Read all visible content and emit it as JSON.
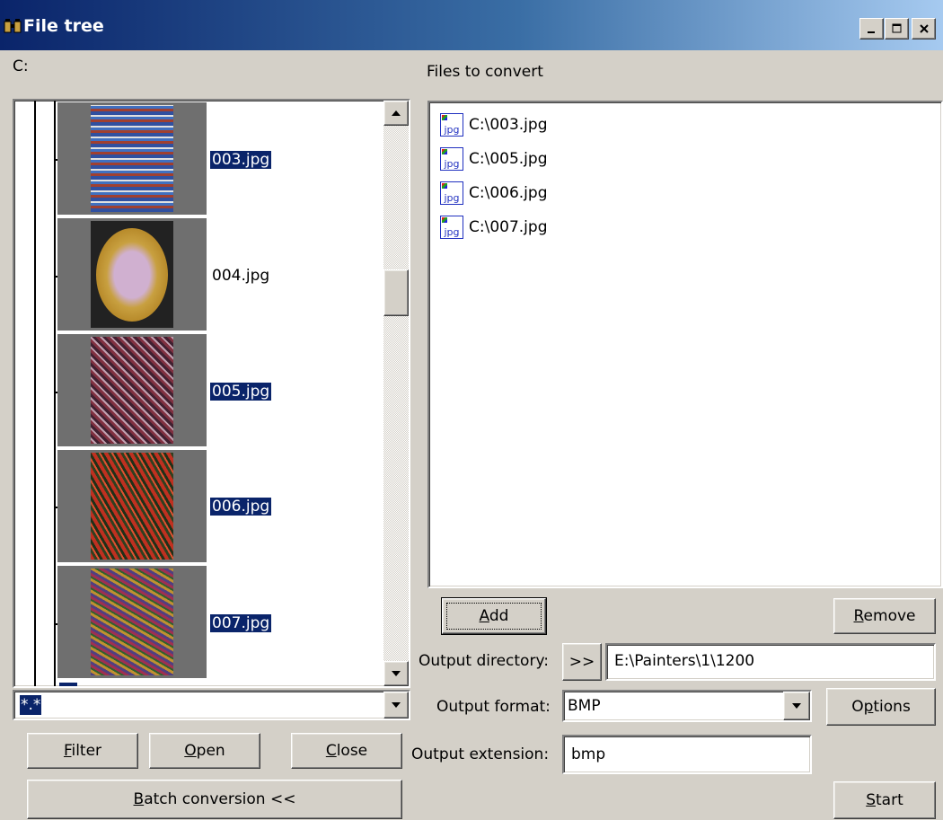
{
  "window": {
    "title": "File tree",
    "controls": [
      "minimize",
      "maximize",
      "close"
    ]
  },
  "tree": {
    "root_label": "C:",
    "items": [
      {
        "name": "003.jpg",
        "selected": true
      },
      {
        "name": "004.jpg",
        "selected": false
      },
      {
        "name": "005.jpg",
        "selected": true
      },
      {
        "name": "006.jpg",
        "selected": true
      },
      {
        "name": "007.jpg",
        "selected": true
      }
    ],
    "filter_value": "*.*"
  },
  "left_buttons": {
    "filter": "Filter",
    "open": "Open",
    "close": "Close",
    "batch": "Batch conversion <<"
  },
  "convert": {
    "heading": "Files to convert",
    "files": [
      "C:\\003.jpg",
      "C:\\005.jpg",
      "C:\\006.jpg",
      "C:\\007.jpg"
    ],
    "file_icon_label": "jpg",
    "add_label": "Add",
    "remove_label": "Remove",
    "output_directory_label": "Output directory:",
    "browse_label": ">>",
    "output_directory_value": "E:\\Painters\\1\\1200",
    "output_format_label": "Output format:",
    "output_format_value": "BMP",
    "options_label": "Options",
    "output_extension_label": "Output extension:",
    "output_extension_value": "bmp",
    "start_label": "Start"
  },
  "colors": {
    "selection": "#0a246a",
    "face": "#d4d0c8",
    "titlebar_start": "#0a246a",
    "titlebar_end": "#a6caf0"
  }
}
